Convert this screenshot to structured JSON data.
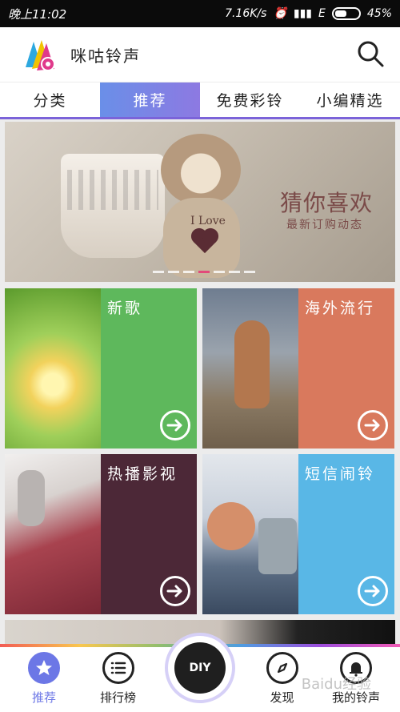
{
  "status": {
    "time": "晚上11:02",
    "network": "7.16K/s",
    "carrier": "E",
    "battery": "45%"
  },
  "app": {
    "title": "咪咕铃声"
  },
  "tabs": [
    {
      "label": "分类",
      "active": false
    },
    {
      "label": "推荐",
      "active": true
    },
    {
      "label": "免费彩铃",
      "active": false
    },
    {
      "label": "小编精选",
      "active": false
    }
  ],
  "banner": {
    "title": "猜你喜欢",
    "subtitle": "最新订购动态",
    "tag": "I Love",
    "carousel": {
      "count": 7,
      "active_index": 3
    }
  },
  "cards": [
    {
      "label": "新歌",
      "color": "#5eb85c"
    },
    {
      "label": "海外流行",
      "color": "#d9795d"
    },
    {
      "label": "热播影视",
      "color": "#4c2837"
    },
    {
      "label": "短信闹铃",
      "color": "#59b7e6"
    }
  ],
  "bottom_nav": {
    "items": [
      {
        "label": "推荐",
        "active": true,
        "icon": "star-icon"
      },
      {
        "label": "排行榜",
        "active": false,
        "icon": "list-icon"
      },
      {
        "label": "发现",
        "active": false,
        "icon": "compass-icon"
      },
      {
        "label": "我的铃声",
        "active": false,
        "icon": "bell-icon"
      }
    ],
    "center": {
      "label": "DIY"
    }
  },
  "watermark": "Baidu经验",
  "colors": {
    "accent": "#6c77e6",
    "tab_gradient_start": "#6a8fe8",
    "tab_gradient_end": "#8d79e2"
  }
}
